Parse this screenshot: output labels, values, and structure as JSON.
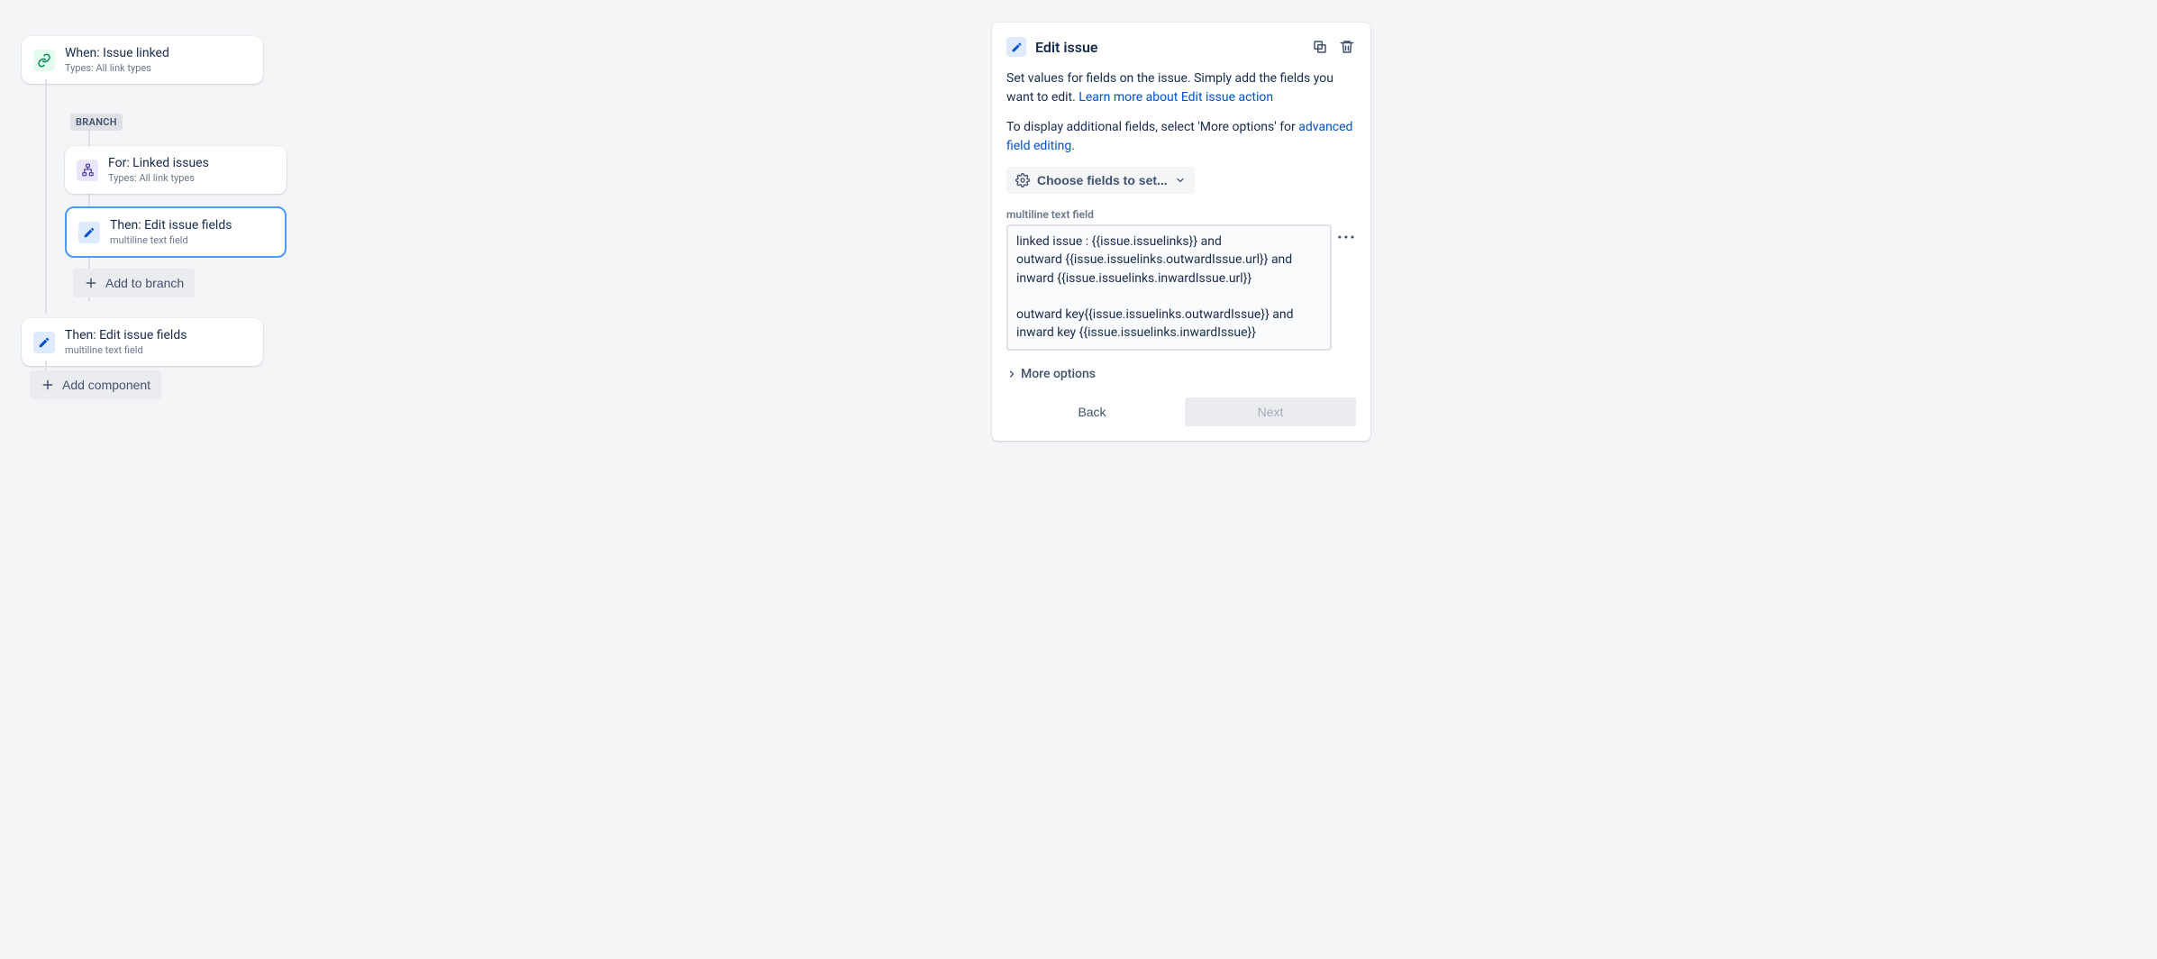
{
  "canvas": {
    "trigger": {
      "title": "When: Issue linked",
      "subtitle": "Types: All link types"
    },
    "branch_label": "BRANCH",
    "branch_for": {
      "title": "For: Linked issues",
      "subtitle": "Types: All link types"
    },
    "branch_action": {
      "title": "Then: Edit issue fields",
      "subtitle": "multiline text field"
    },
    "add_to_branch": "Add to branch",
    "then_action": {
      "title": "Then: Edit issue fields",
      "subtitle": "multiline text field"
    },
    "add_component": "Add component"
  },
  "panel": {
    "title": "Edit issue",
    "desc_pre": "Set values for fields on the issue. Simply add the fields you want to edit. ",
    "desc_link": "Learn more about Edit issue action",
    "desc2_pre": "To display additional fields, select 'More options' for ",
    "desc2_link": "advanced field editing",
    "desc2_post": ".",
    "choose_fields": "Choose fields to set...",
    "field_label": "multiline text field",
    "field_value": "linked issue : {{issue.issuelinks}} and\noutward {{issue.issuelinks.outwardIssue.url}} and\ninward {{issue.issuelinks.inwardIssue.url}}\n\noutward key{{issue.issuelinks.outwardIssue}} and\ninward key {{issue.issuelinks.inwardIssue}}",
    "more_options": "More options",
    "back": "Back",
    "next": "Next"
  }
}
